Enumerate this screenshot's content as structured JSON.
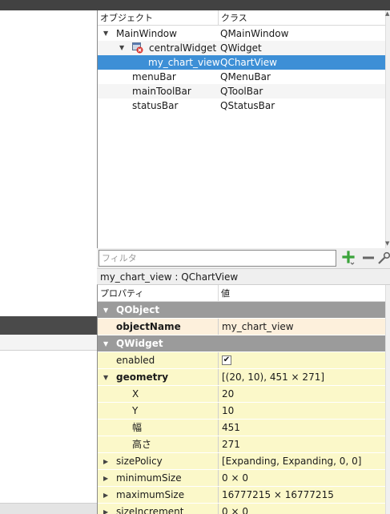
{
  "object_inspector": {
    "headers": {
      "object": "オブジェクト",
      "class": "クラス"
    },
    "rows": [
      {
        "name": "MainWindow",
        "class": "QMainWindow"
      },
      {
        "name": "centralWidget",
        "class": "QWidget"
      },
      {
        "name": "my_chart_view",
        "class": "QChartView"
      },
      {
        "name": "menuBar",
        "class": "QMenuBar"
      },
      {
        "name": "mainToolBar",
        "class": "QToolBar"
      },
      {
        "name": "statusBar",
        "class": "QStatusBar"
      }
    ],
    "filter_placeholder": "フィルタ",
    "colors": {
      "selection": "#3d8fd6"
    },
    "icons": [
      "expand-arrow-icon",
      "widget-error-icon",
      "add-icon",
      "remove-icon",
      "configure-icon"
    ]
  },
  "selected_object_label": "my_chart_view : QChartView",
  "property_editor": {
    "headers": {
      "property": "プロパティ",
      "value": "値"
    },
    "groups": {
      "qobject": "QObject",
      "qwidget": "QWidget"
    },
    "rows": {
      "objectName": {
        "name": "objectName",
        "value": "my_chart_view"
      },
      "enabled": {
        "name": "enabled",
        "checked": true
      },
      "geometry": {
        "name": "geometry",
        "value": "[(20, 10), 451 × 271]"
      },
      "x": {
        "name": "X",
        "value": "20"
      },
      "y": {
        "name": "Y",
        "value": "10"
      },
      "width": {
        "name": "幅",
        "value": "451"
      },
      "height": {
        "name": "高さ",
        "value": "271"
      },
      "sizePolicy": {
        "name": "sizePolicy",
        "value": "[Expanding, Expanding, 0, 0]"
      },
      "minimumSize": {
        "name": "minimumSize",
        "value": "0 × 0"
      },
      "maximumSize": {
        "name": "maximumSize",
        "value": "16777215 × 16777215"
      },
      "sizeIncrement": {
        "name": "sizeIncrement",
        "value": "0 × 0"
      }
    },
    "colors": {
      "group": "#9b9b9b",
      "qobject_row": "#fdf0dc",
      "qwidget_row": "#fbf8c9"
    }
  }
}
